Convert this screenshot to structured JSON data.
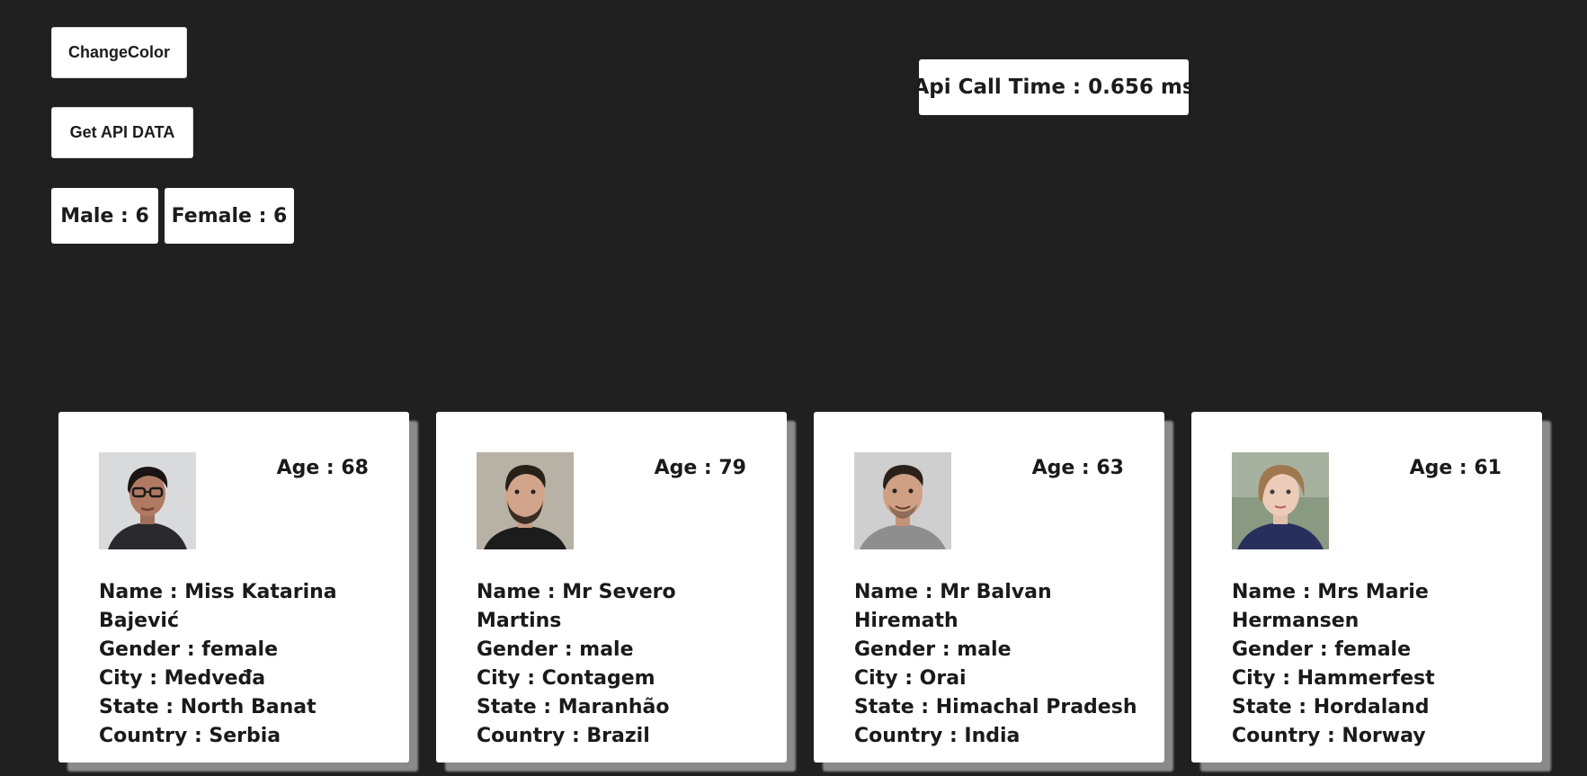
{
  "controls": {
    "change_color_label": "ChangeColor",
    "get_api_label": "Get API DATA"
  },
  "stats": {
    "male": "Male : 6",
    "female": "Female : 6",
    "api_call_time": "Api Call Time : 0.656 ms"
  },
  "colors": {
    "background": "#202020",
    "card": "#ffffff",
    "card_shadow": "#8a8a8a"
  },
  "cards": [
    {
      "avatar": "woman-with-glasses-photo",
      "age": "Age : 68",
      "name": "Name : Miss Katarina Bajević",
      "gender": "Gender : female",
      "city": "City : Medveđa",
      "state": "State : North Banat",
      "country": "Country : Serbia"
    },
    {
      "avatar": "bearded-man-photo",
      "age": "Age : 79",
      "name": "Name : Mr Severo Martins",
      "gender": "Gender : male",
      "city": "City : Contagem",
      "state": "State : Maranhão",
      "country": "Country : Brazil"
    },
    {
      "avatar": "smiling-man-photo",
      "age": "Age : 63",
      "name": "Name : Mr Balvan Hiremath",
      "gender": "Gender : male",
      "city": "City : Orai",
      "state": "State : Himachal Pradesh",
      "country": "Country : India"
    },
    {
      "avatar": "young-woman-photo",
      "age": "Age : 61",
      "name": "Name : Mrs Marie Hermansen",
      "gender": "Gender : female",
      "city": "City : Hammerfest",
      "state": "State : Hordaland",
      "country": "Country : Norway"
    }
  ]
}
